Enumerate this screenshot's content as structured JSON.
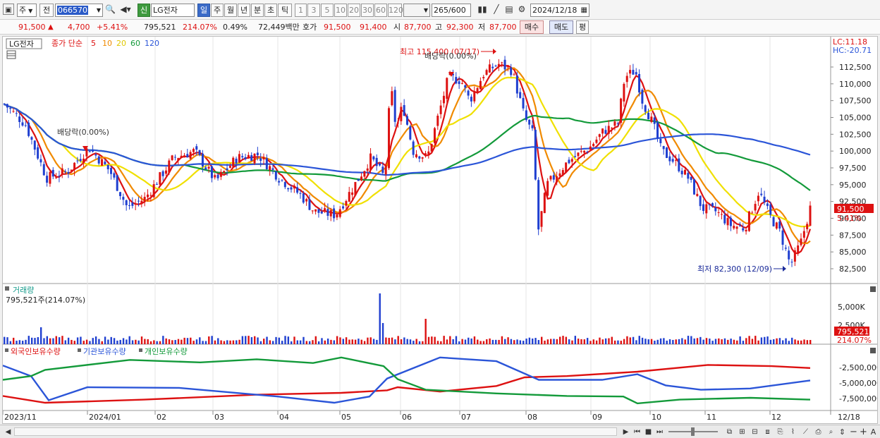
{
  "toolbar": {
    "market": "주",
    "prev_label": "전",
    "code": "066570",
    "stock_name": "LG전자",
    "credit_badge": "신",
    "periods": [
      "일",
      "주",
      "월",
      "년",
      "분",
      "초",
      "틱"
    ],
    "selected_period": "일",
    "intervals": [
      "1",
      "3",
      "5",
      "10",
      "20",
      "30",
      "60",
      "120"
    ],
    "count_value": "265",
    "count_total": "/600",
    "date": "2024/12/18"
  },
  "quote": {
    "price": "91,500",
    "change": "4,700",
    "change_pct": "+5.41%",
    "volume": "795,521",
    "volume_ratio": "214.07%",
    "turnover": "0.49%",
    "amount": "72,449백만",
    "bid_label": "호가",
    "bid1": "91,500",
    "bid2": "91,400",
    "open_label": "시",
    "open": "87,700",
    "high_label": "고",
    "high": "92,300",
    "low_label": "저",
    "low": "87,700",
    "buy_label": "매수",
    "sell_label": "매도",
    "eval_label": "평"
  },
  "price_panel": {
    "name_tag": "LG전자",
    "legend_prefix": "종가 단순",
    "ma_periods": [
      "5",
      "10",
      "20",
      "60",
      "120"
    ],
    "ma_colors": [
      "#dd1111",
      "#f08a00",
      "#f0e000",
      "#139a3a",
      "#2b55d8"
    ],
    "lc": "LC:11.18",
    "hc": "HC:-20.71",
    "y_ticks": [
      "112,500",
      "110,000",
      "107,500",
      "105,000",
      "102,500",
      "100,000",
      "97,500",
      "95,000",
      "92,500",
      "90,000",
      "87,500",
      "85,000",
      "82,500"
    ],
    "last_price_tag": "91,500",
    "last_pct_tag": "5.41%",
    "high_annot": "최고 115,400 (07/17)",
    "low_annot": "최저 82,300 (12/09)",
    "div1": "배당락(0.00%)",
    "div2": "배당락(0.00%)"
  },
  "volume_panel": {
    "title": "거래량",
    "info": "795,521주(214.07%)",
    "y_ticks": [
      "5,000K",
      "2,500K"
    ],
    "last_tag": "795,521",
    "last_pct": "214.07%"
  },
  "holdings_panel": {
    "legend": [
      "외국인보유수량",
      "기관보유수량",
      "개인보유수량"
    ],
    "colors": [
      "#dd1111",
      "#2b55d8",
      "#139a3a"
    ],
    "y_ticks": [
      "-2,500,000",
      "-5,000,000",
      "-7,500,000"
    ]
  },
  "x_axis": [
    "2023/11",
    "2024/01",
    "02",
    "03",
    "04",
    "05",
    "06",
    "07",
    "08",
    "09",
    "10",
    "11",
    "12",
    "12/18"
  ]
}
